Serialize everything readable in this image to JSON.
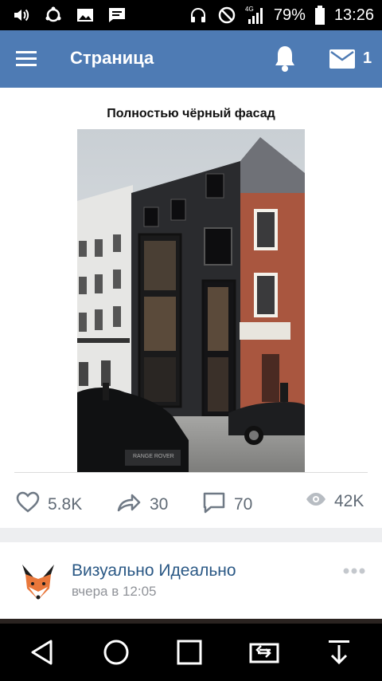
{
  "statusbar": {
    "battery_percent": "79%",
    "time": "13:26",
    "network": "4G",
    "icons": [
      "volume-icon",
      "sync-icon",
      "gallery-icon",
      "message-icon",
      "headset-icon",
      "do-not-disturb-icon",
      "signal-icon",
      "battery-icon"
    ]
  },
  "appbar": {
    "title": "Страница",
    "mail_count": "1",
    "icons": [
      "menu-icon",
      "bell-icon",
      "mail-icon"
    ]
  },
  "post": {
    "title": "Полностью чёрный фасад",
    "likes": "5.8K",
    "shares": "30",
    "comments": "70",
    "views": "42K"
  },
  "next_post": {
    "author": "Визуально Идеально",
    "time": "вчера в 12:05"
  },
  "navbar": {
    "icons": [
      "back-icon",
      "home-icon",
      "recents-icon",
      "screen-cast-icon",
      "download-icon"
    ]
  }
}
